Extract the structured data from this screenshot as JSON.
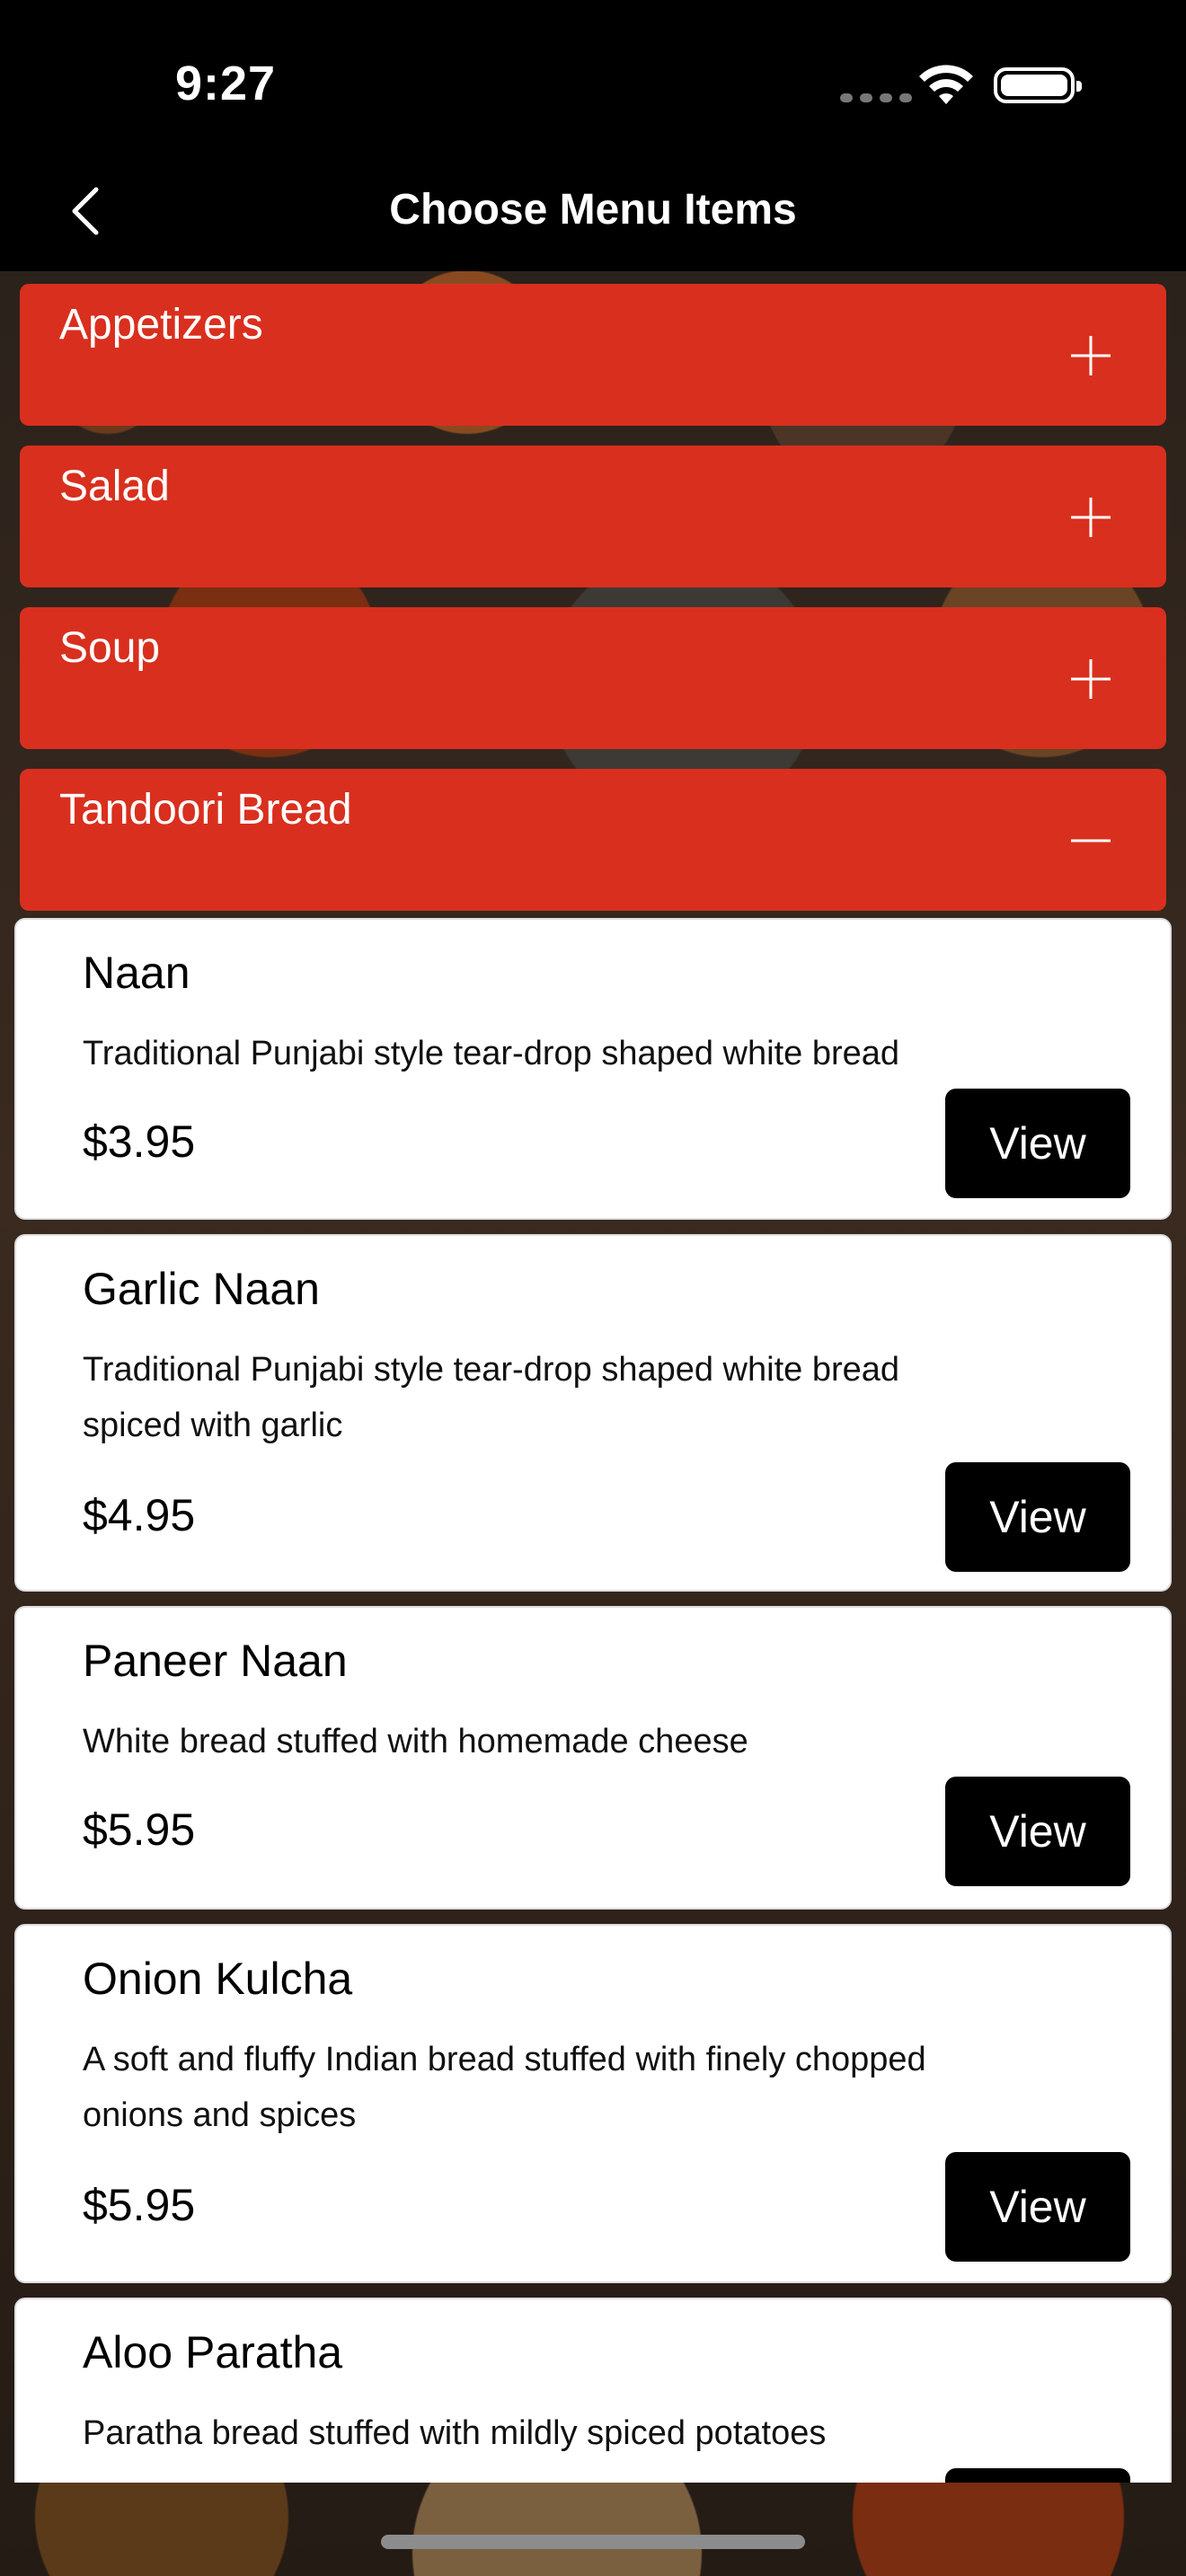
{
  "status_bar": {
    "time": "9:27"
  },
  "nav": {
    "title": "Choose Menu Items",
    "back_icon": "chevron-left-icon"
  },
  "categories": [
    {
      "label": "Appetizers",
      "expanded": false
    },
    {
      "label": "Salad",
      "expanded": false
    },
    {
      "label": "Soup",
      "expanded": false
    },
    {
      "label": "Tandoori Bread",
      "expanded": true
    }
  ],
  "items": [
    {
      "name": "Naan",
      "description": "Traditional Punjabi style tear-drop shaped white bread",
      "price": "$3.95",
      "button": "View"
    },
    {
      "name": "Garlic Naan",
      "description": "Traditional Punjabi style tear-drop shaped white bread spiced with garlic",
      "price": "$4.95",
      "button": "View"
    },
    {
      "name": "Paneer Naan",
      "description": "White bread stuffed with homemade cheese",
      "price": "$5.95",
      "button": "View"
    },
    {
      "name": "Onion Kulcha",
      "description": "A soft and fluffy Indian bread stuffed with finely chopped onions and spices",
      "price": "$5.95",
      "button": "View"
    },
    {
      "name": "Aloo Paratha",
      "description": "Paratha bread stuffed with mildly spiced potatoes",
      "price": "",
      "button": ""
    }
  ],
  "colors": {
    "accent": "#d92f1e",
    "button": "#000000"
  }
}
